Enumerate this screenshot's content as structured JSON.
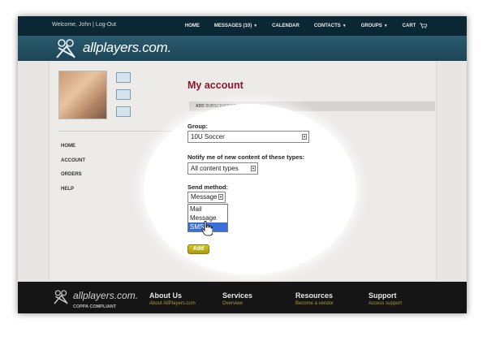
{
  "header": {
    "welcome": "Welcome, John | Log-Out",
    "nav": [
      {
        "label": "HOME",
        "caret": false
      },
      {
        "label": "MESSAGES (10)",
        "caret": true
      },
      {
        "label": "CALENDAR",
        "caret": false
      },
      {
        "label": "CONTACTS",
        "caret": true
      },
      {
        "label": "GROUPS",
        "caret": true
      },
      {
        "label": "CART",
        "caret": false
      }
    ],
    "brand": "allplayers.com."
  },
  "sidebar": {
    "items": [
      "HOME",
      "ACCOUNT",
      "ORDERS",
      "HELP"
    ]
  },
  "main": {
    "title": "My account",
    "section": "ADD SUBSCRIPTION",
    "group_label": "Group:",
    "group_value": "10U Soccer",
    "notify_label": "Notify me of new content of these types:",
    "notify_value": "All content types",
    "send_label": "Send method:",
    "send_value": "Message",
    "send_options": [
      "Mail",
      "Message",
      "SMS"
    ],
    "send_highlighted": "SMS",
    "add_button": "Add"
  },
  "footer": {
    "brand": "allplayers.com.",
    "coppa": "COPPA COMPLIANT",
    "columns": [
      {
        "heading": "About Us",
        "link": "About AllPlayers.com"
      },
      {
        "heading": "Services",
        "link": "Overview"
      },
      {
        "heading": "Resources",
        "link": "Become a vendor"
      },
      {
        "heading": "Support",
        "link": "Access support"
      }
    ]
  },
  "colors": {
    "topbar": "#0b2733",
    "brandbar": "#2b5b6e",
    "title": "#8b1530",
    "highlight": "#3a6fd8",
    "add_button": "#c4b618"
  }
}
